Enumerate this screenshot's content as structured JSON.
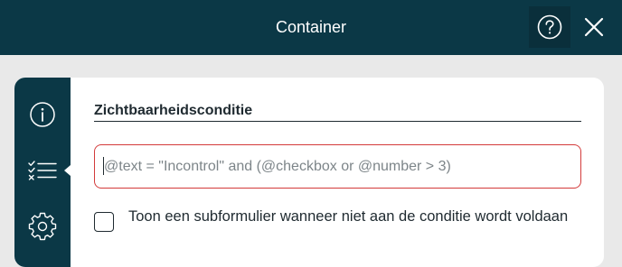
{
  "header": {
    "title": "Container",
    "help_icon": "question-circle-icon",
    "close_icon": "close-icon"
  },
  "side_rail": {
    "items": [
      {
        "icon": "info-icon"
      },
      {
        "icon": "checklist-icon",
        "active": true
      },
      {
        "icon": "gear-icon"
      }
    ]
  },
  "content": {
    "section_title": "Zichtbaarheidsconditie",
    "condition_input": {
      "value": "",
      "placeholder": "@text = \"Incontrol\" and (@checkbox or @number > 3)"
    },
    "subform_checkbox": {
      "checked": false,
      "label": "Toon een subformulier wanneer niet aan de conditie wordt voldaan"
    }
  },
  "colors": {
    "header_bg": "#0b3846",
    "error_border": "#d33b3b",
    "page_bg": "#e9e9e9"
  }
}
